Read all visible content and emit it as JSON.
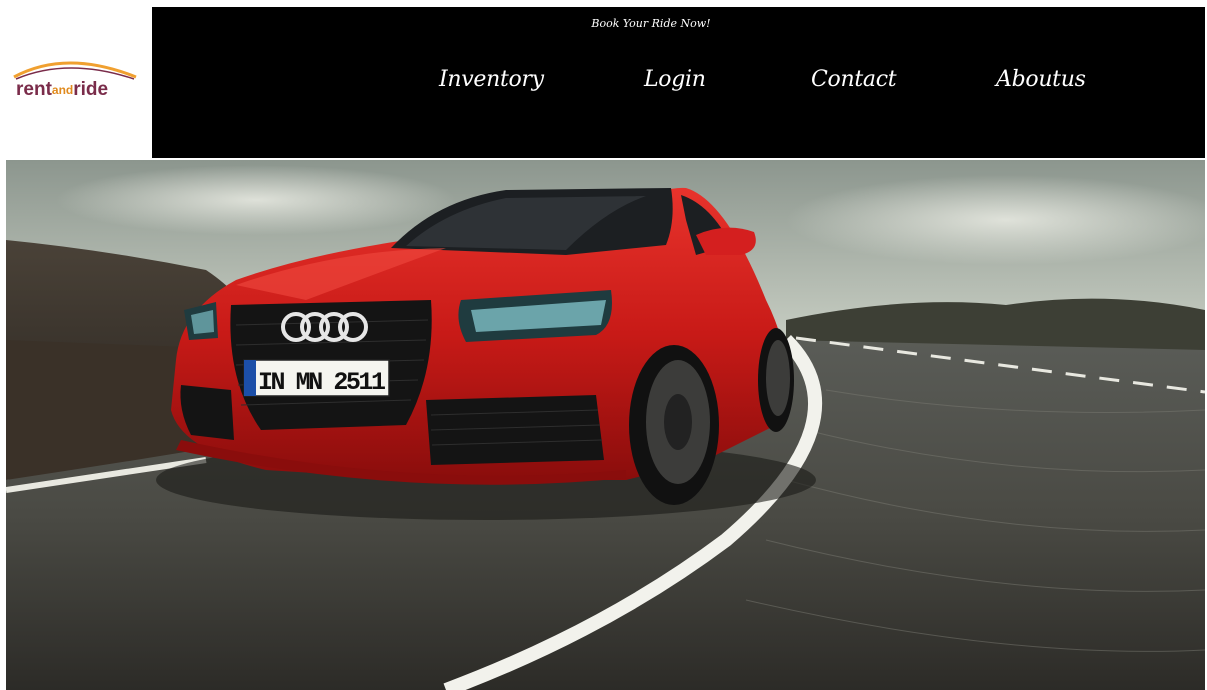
{
  "header": {
    "tagline": "Book Your Ride Now!",
    "logo": {
      "text_part1": "rent",
      "text_part2": "and",
      "text_part3": "ride",
      "colors": {
        "primary": "#7a2c4a",
        "accent": "#e08a1e",
        "swoosh": "#f0a030"
      }
    },
    "nav": [
      {
        "label": "Inventory"
      },
      {
        "label": "Login"
      },
      {
        "label": "Contact"
      },
      {
        "label": "Aboutus"
      }
    ]
  },
  "hero": {
    "plate_text": "IN MN 2511",
    "car_color": "#d41f1f"
  }
}
